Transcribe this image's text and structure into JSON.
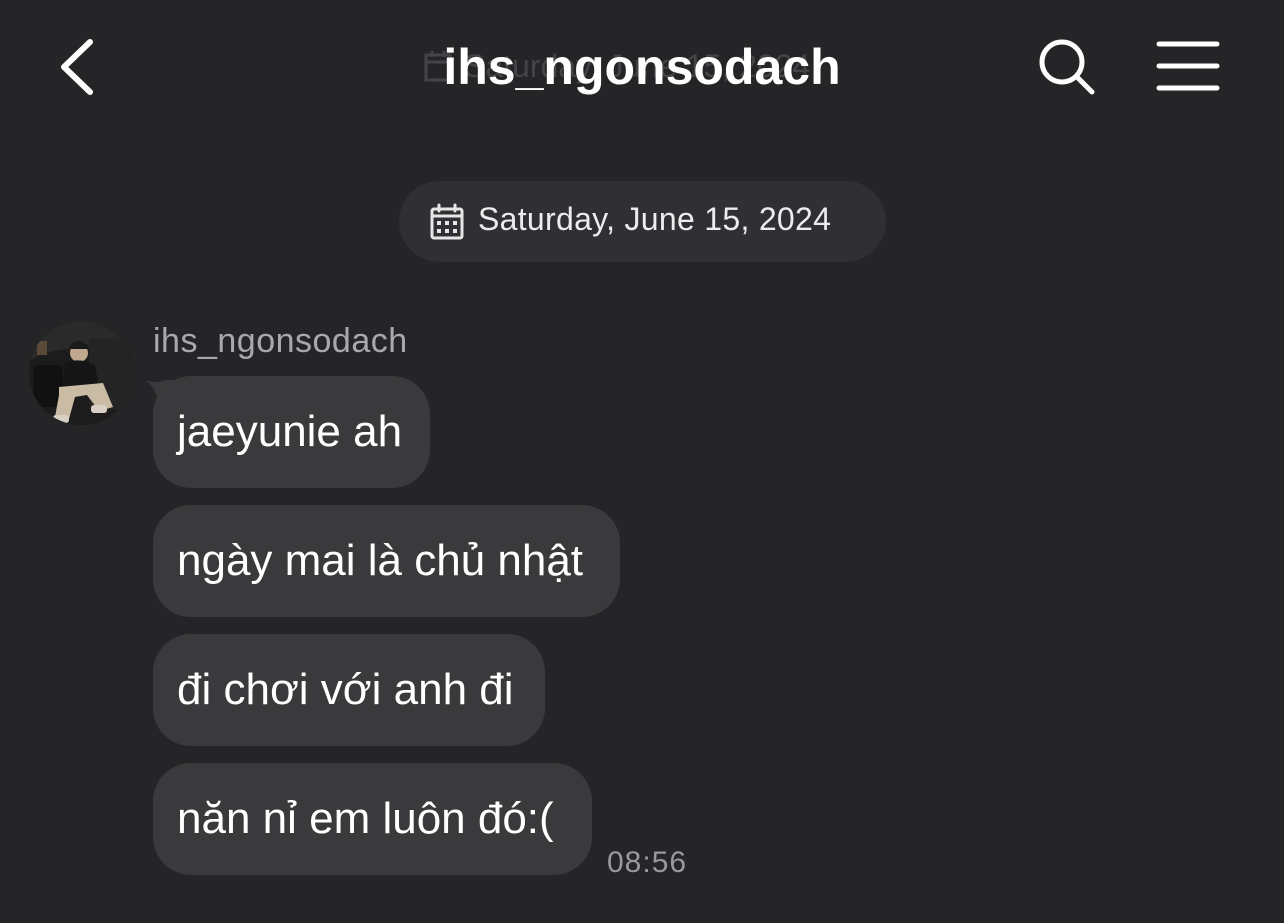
{
  "header": {
    "title": "ihs_ngonsodach",
    "ghost_date": "Saturday, June 15, 2024",
    "back_icon": "chevron-left-icon",
    "search_icon": "search-icon",
    "menu_icon": "hamburger-menu-icon"
  },
  "date_separator": {
    "icon": "calendar-icon",
    "text": "Saturday, June 15, 2024"
  },
  "conversation": {
    "sender": {
      "name": "ihs_ngonsodach",
      "avatar": "avatar-photo"
    },
    "messages": [
      {
        "text": "jaeyunie ah"
      },
      {
        "text": "ngày mai là chủ nhật"
      },
      {
        "text": "đi chơi với anh đi"
      },
      {
        "text": "năn nỉ em luôn đó:("
      }
    ],
    "time": "08:56"
  },
  "colors": {
    "background": "#252528",
    "bubble": "#3a3a3c",
    "pill": "#303034",
    "secondary_text": "#a9a9ad"
  }
}
